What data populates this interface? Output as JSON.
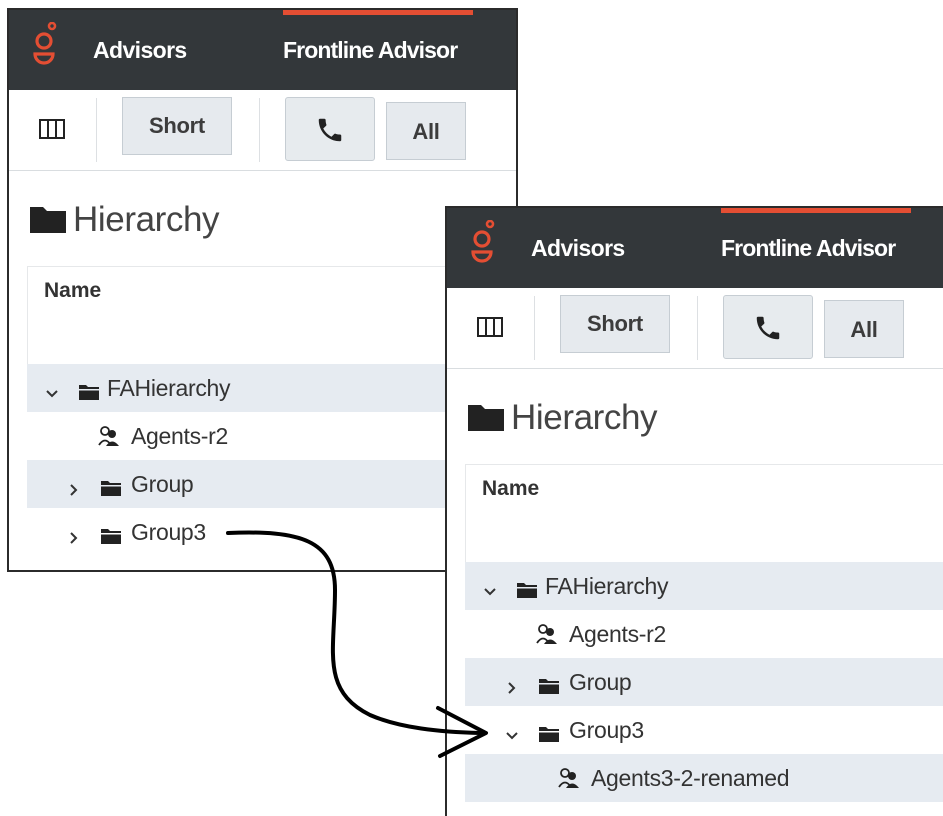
{
  "colors": {
    "header_bg": "#33373a",
    "accent": "#e44e33",
    "row_shade": "#e6ebf1",
    "button_bg": "#e6eaee"
  },
  "icons": [
    "genesys-logo-icon",
    "columns-icon",
    "phone-icon",
    "folder-icon",
    "agent-group-icon",
    "chevron-down-icon",
    "chevron-right-icon"
  ],
  "panel_before": {
    "nav": {
      "advisors": "Advisors",
      "frontline": "Frontline Advisor"
    },
    "toolbar": {
      "short_label": "Short",
      "all_label": "All"
    },
    "section_title": "Hierarchy",
    "table": {
      "column_header": "Name",
      "rows": [
        {
          "label": "FAHierarchy",
          "type": "folder",
          "state": "expanded"
        },
        {
          "label": "Agents-r2",
          "type": "agent-group"
        },
        {
          "label": "Group",
          "type": "folder",
          "state": "collapsed"
        },
        {
          "label": "Group3",
          "type": "folder",
          "state": "collapsed"
        }
      ]
    }
  },
  "panel_after": {
    "nav": {
      "advisors": "Advisors",
      "frontline": "Frontline Advisor"
    },
    "toolbar": {
      "short_label": "Short",
      "all_label": "All"
    },
    "section_title": "Hierarchy",
    "table": {
      "column_header": "Name",
      "rows": [
        {
          "label": "FAHierarchy",
          "type": "folder",
          "state": "expanded"
        },
        {
          "label": "Agents-r2",
          "type": "agent-group"
        },
        {
          "label": "Group",
          "type": "folder",
          "state": "collapsed"
        },
        {
          "label": "Group3",
          "type": "folder",
          "state": "expanded"
        },
        {
          "label": "Agents3-2-renamed",
          "type": "agent-group"
        }
      ]
    }
  }
}
